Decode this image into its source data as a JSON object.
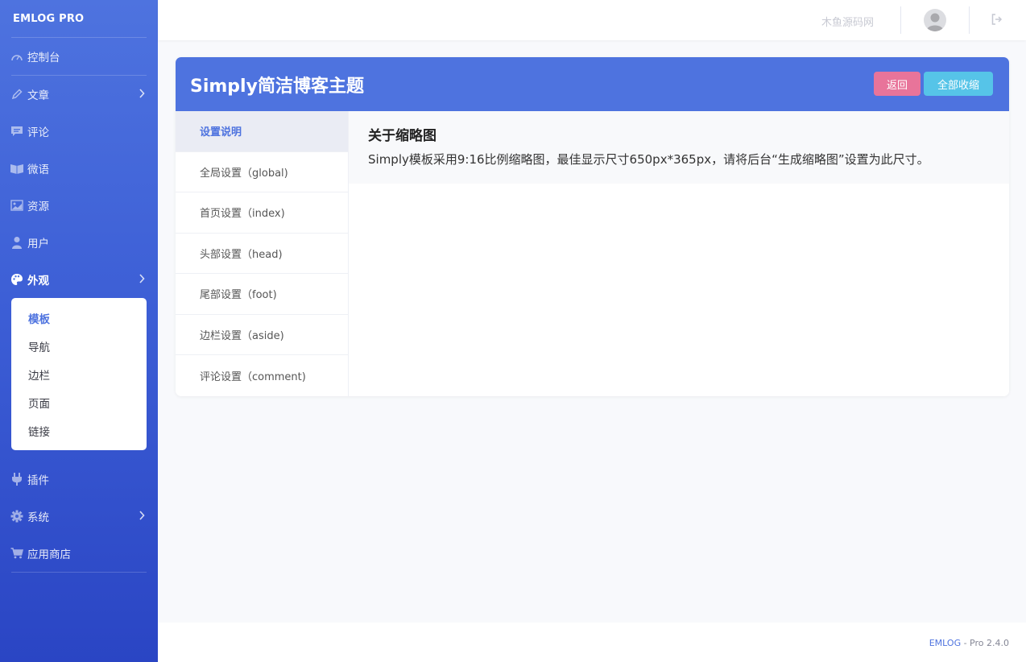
{
  "sidebar": {
    "brand": "EMLOG PRO",
    "items": [
      {
        "label": "控制台",
        "icon": "dashboard-icon"
      },
      {
        "label": "文章",
        "icon": "pencil-icon"
      },
      {
        "label": "评论",
        "icon": "comment-icon"
      },
      {
        "label": "微语",
        "icon": "chat-icon"
      },
      {
        "label": "资源",
        "icon": "image-icon"
      },
      {
        "label": "用户",
        "icon": "user-icon"
      },
      {
        "label": "外观",
        "icon": "palette-icon"
      },
      {
        "label": "插件",
        "icon": "plug-icon"
      },
      {
        "label": "系统",
        "icon": "gear-icon"
      },
      {
        "label": "应用商店",
        "icon": "cart-icon"
      }
    ],
    "submenu": [
      "模板",
      "导航",
      "边栏",
      "页面",
      "链接"
    ]
  },
  "topbar": {
    "site_name": "木鱼源码网"
  },
  "card": {
    "title": "Simply简洁博客主题",
    "back_label": "返回",
    "collapse_label": "全部收缩",
    "tabs": [
      "设置说明",
      "全局设置（global)",
      "首页设置（index)",
      "头部设置（head)",
      "尾部设置（foot)",
      "边栏设置（aside)",
      "评论设置（comment)"
    ],
    "content": {
      "title": "关于缩略图",
      "text": "Simply模板采用9:16比例缩略图，最佳显示尺寸650px*365px，请将后台“生成缩略图”设置为此尺寸。"
    }
  },
  "footer": {
    "brand": "EMLOG",
    "version": "- Pro 2.4.0"
  },
  "colors": {
    "primary": "#4e73df",
    "back_button": "#e8749a",
    "collapse_button": "#56c4e8"
  }
}
